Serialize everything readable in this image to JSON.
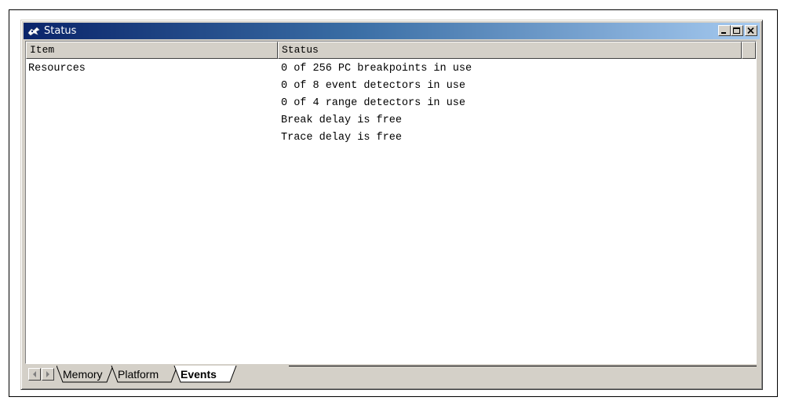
{
  "window": {
    "title": "Status",
    "buttons": [
      "minimize",
      "maximize",
      "close"
    ]
  },
  "columns": [
    "Item",
    "Status"
  ],
  "rows": [
    {
      "item": "Resources",
      "status": "0 of 256 PC breakpoints in use"
    },
    {
      "item": "",
      "status": "0 of 8 event detectors in use"
    },
    {
      "item": "",
      "status": "0 of 4 range detectors in use"
    },
    {
      "item": "",
      "status": "Break delay is free"
    },
    {
      "item": "",
      "status": "Trace delay is free"
    }
  ],
  "tabs": [
    {
      "label": "Memory",
      "active": false
    },
    {
      "label": "Platform",
      "active": false
    },
    {
      "label": "Events",
      "active": true
    }
  ],
  "icons": {
    "title": "status-window-icon",
    "scroll_left": "scroll-left-icon",
    "scroll_right": "scroll-right-icon"
  }
}
